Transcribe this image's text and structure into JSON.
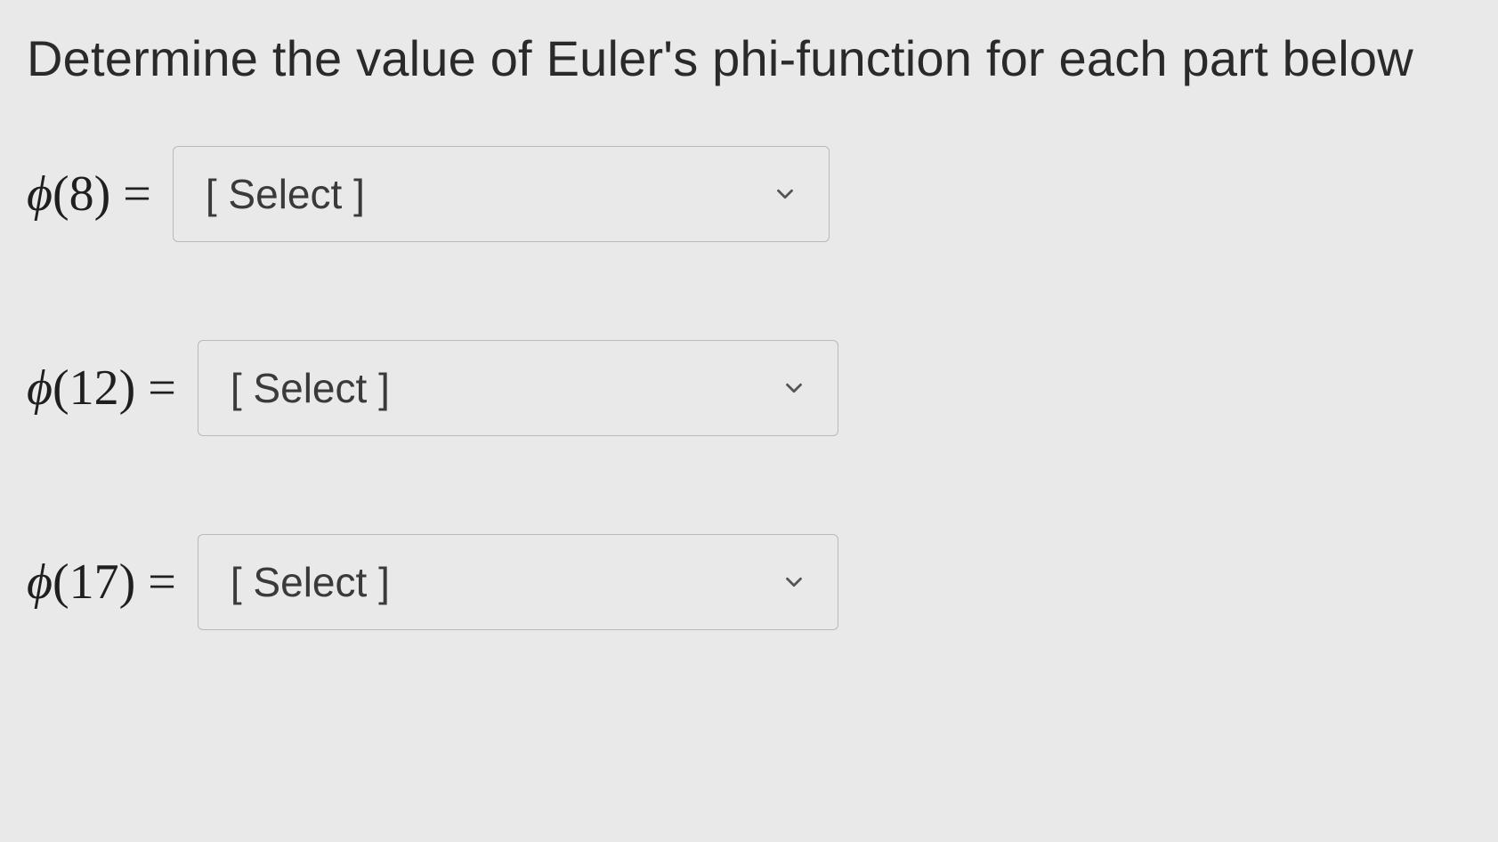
{
  "prompt": "Determine the value of Euler's phi-function for each part below",
  "rows": [
    {
      "lhs_phi": "ϕ",
      "lhs_arg": "(8) =",
      "select_placeholder": "[ Select ]"
    },
    {
      "lhs_phi": "ϕ",
      "lhs_arg": "(12) =",
      "select_placeholder": "[ Select ]"
    },
    {
      "lhs_phi": "ϕ",
      "lhs_arg": "(17) =",
      "select_placeholder": "[ Select ]"
    }
  ]
}
